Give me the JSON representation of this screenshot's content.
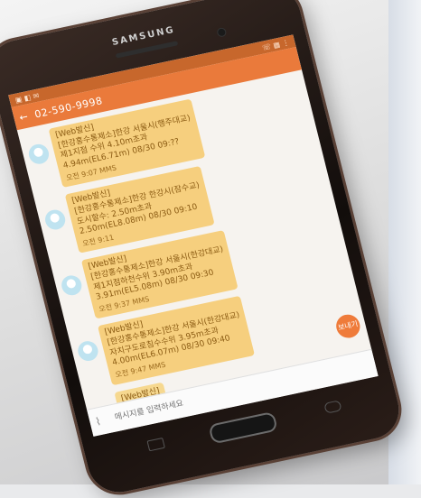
{
  "device": {
    "brand": "SAMSUNG"
  },
  "statusbar": {
    "left_icons": "▣ ◧ ✉",
    "right_icons": "☏ ▦ ⋮"
  },
  "header": {
    "back_icon": "←",
    "title": "02-590-9998"
  },
  "messages": [
    {
      "lines": [
        "[Web발신]",
        "[한강홍수통제소]한강 서울시(행주대교)",
        "제1지점 수위 4.10m초과",
        "4.94m(EL6.71m) 08/30 09:??"
      ],
      "time": "오전 9:07 MMS"
    },
    {
      "lines": [
        "[Web발신]",
        "[한강홍수통제소]한강 한강시(잠수교)",
        "도시할수: 2.50m초과",
        "2.50m(EL8.08m) 08/30 09:10"
      ],
      "time": "오전 9:11"
    },
    {
      "lines": [
        "[Web발신]",
        "[한강홍수통제소]한강 서울시(한강대교)",
        "제1지점하천수위 3.90m초과",
        "3.91m(EL5.08m) 08/30 09:30"
      ],
      "time": "오전 9:37 MMS"
    },
    {
      "lines": [
        "[Web발신]",
        "[한강홍수통제소]한강 서울시(한강대교)",
        "자치구도로침수수위 3.95m초과",
        "4.00m(EL6.07m) 08/30 09:40"
      ],
      "time": "오전 9:47 MMS"
    },
    {
      "lines": [
        "[Web발신]"
      ],
      "time": ""
    }
  ],
  "composer": {
    "placeholder": "메시지를 입력하세요",
    "attach_icon": "⌇"
  },
  "fab": {
    "label": "보내기"
  }
}
